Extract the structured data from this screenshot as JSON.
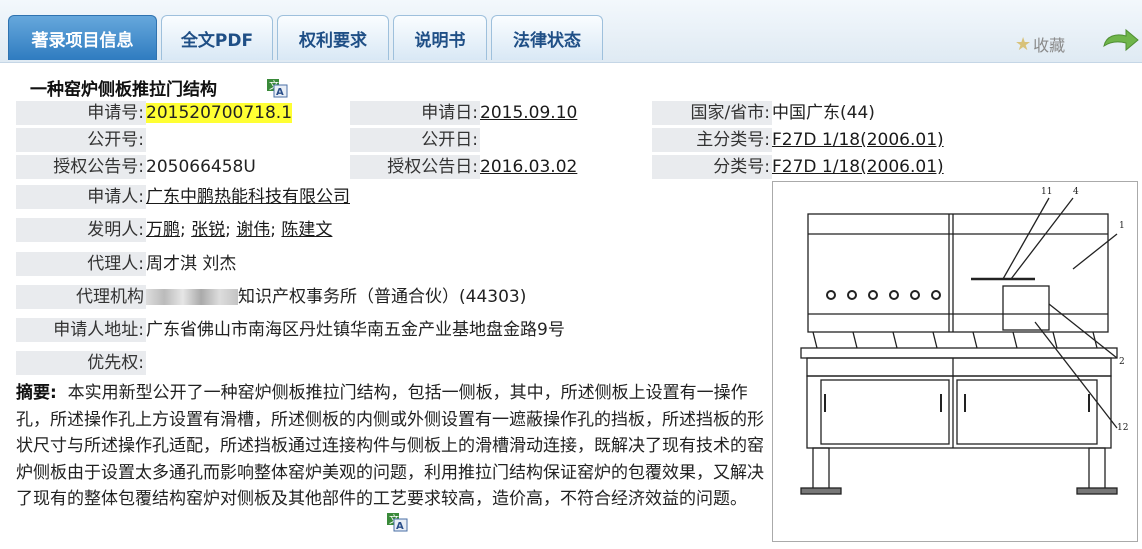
{
  "tabs": [
    {
      "label": "著录项目信息"
    },
    {
      "label": "全文PDF"
    },
    {
      "label": "权利要求"
    },
    {
      "label": "说明书"
    },
    {
      "label": "法律状态"
    }
  ],
  "favorite_label": "收藏",
  "title": "一种窑炉侧板推拉门结构",
  "fields": {
    "app_no_label": "申请号:",
    "app_no": "201520700718.1",
    "app_date_label": "申请日:",
    "app_date": "2015.09.10",
    "country_label": "国家/省市:",
    "country": "中国广东(44)",
    "pub_no_label": "公开号:",
    "pub_no": "",
    "pub_date_label": "公开日:",
    "pub_date": "",
    "main_class_label": "主分类号:",
    "main_class": "F27D 1/18(2006.01)",
    "grant_no_label": "授权公告号:",
    "grant_no": "205066458U",
    "grant_date_label": "授权公告日:",
    "grant_date": "2016.03.02",
    "class_label": "分类号:",
    "class": "F27D 1/18(2006.01)",
    "applicant_label": "申请人:",
    "applicant": "广东中鹏热能科技有限公司",
    "inventor_label": "发明人:",
    "inventors": [
      "万鹏",
      "张锐",
      "谢伟",
      "陈建文"
    ],
    "inventor_sep": ";",
    "agent_label": "代理人:",
    "agent": "周才淇 刘杰",
    "agency_label": "代理机构",
    "agency": "知识产权事务所（普通合伙）(44303)",
    "address_label": "申请人地址:",
    "address": "广东省佛山市南海区丹灶镇华南五金产业基地盘金路9号",
    "priority_label": "优先权:",
    "priority": ""
  },
  "abstract": {
    "label": "摘要:",
    "text": "本实用新型公开了一种窑炉侧板推拉门结构，包括一侧板，其中，所述侧板上设置有一操作孔，所述操作孔上方设置有滑槽，所述侧板的内侧或外侧设置有一遮蔽操作孔的挡板，所述挡板的形状尺寸与所述操作孔适配，所述挡板通过连接构件与侧板上的滑槽滑动连接，既解决了现有技术的窑炉侧板由于设置太多通孔而影响整体窑炉美观的问题，利用推拉门结构保证窑炉的包覆效果，又解决了现有的整体包覆结构窑炉对侧板及其他部件的工艺要求较高，造价高，不符合经济效益的问题。"
  },
  "drawing_labels": [
    "11",
    "4",
    "1",
    "2",
    "12"
  ],
  "colors": {
    "tab_active": "#2f7cc0",
    "highlight": "#ffff33",
    "label_bg": "#e9ebee"
  }
}
